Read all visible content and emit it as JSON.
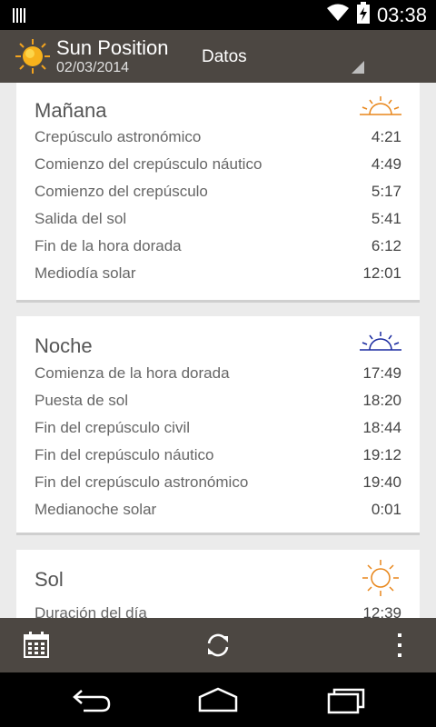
{
  "status_bar": {
    "time": "03:38",
    "icons": [
      "signal-bars-icon",
      "wifi-icon",
      "battery-charging-icon"
    ]
  },
  "action_bar": {
    "app_title": "Sun Position",
    "date": "02/03/2014",
    "view_selector": "Datos"
  },
  "cards": [
    {
      "title": "Mañana",
      "icon": "sunrise-icon",
      "icon_color": "#e8861a",
      "rows": [
        {
          "label": "Crepúsculo astronómico",
          "value": "4:21"
        },
        {
          "label": "Comienzo del crepúsculo náutico",
          "value": "4:49"
        },
        {
          "label": "Comienzo del crepúsculo",
          "value": "5:17"
        },
        {
          "label": "Salida del sol",
          "value": "5:41"
        },
        {
          "label": "Fin de la hora dorada",
          "value": "6:12"
        },
        {
          "label": "Mediodía solar",
          "value": "12:01"
        }
      ]
    },
    {
      "title": "Noche",
      "icon": "sunset-icon",
      "icon_color": "#1a2aa0",
      "rows": [
        {
          "label": "Comienza de la hora dorada",
          "value": "17:49"
        },
        {
          "label": "Puesta de sol",
          "value": "18:20"
        },
        {
          "label": "Fin del crepúsculo civil",
          "value": "18:44"
        },
        {
          "label": "Fin del crepúsculo náutico",
          "value": "19:12"
        },
        {
          "label": "Fin del crepúsculo astronómico",
          "value": "19:40"
        },
        {
          "label": "Medianoche solar",
          "value": "0:01"
        }
      ]
    },
    {
      "title": "Sol",
      "icon": "sun-icon",
      "icon_color": "#e8861a",
      "rows": [
        {
          "label": "Duración del día",
          "value": "12:39"
        }
      ]
    }
  ],
  "bottom_bar": {
    "buttons": [
      "calendar-icon",
      "refresh-icon",
      "overflow-menu-icon"
    ]
  },
  "nav_bar": {
    "buttons": [
      "back-icon",
      "home-icon",
      "recent-apps-icon"
    ]
  }
}
